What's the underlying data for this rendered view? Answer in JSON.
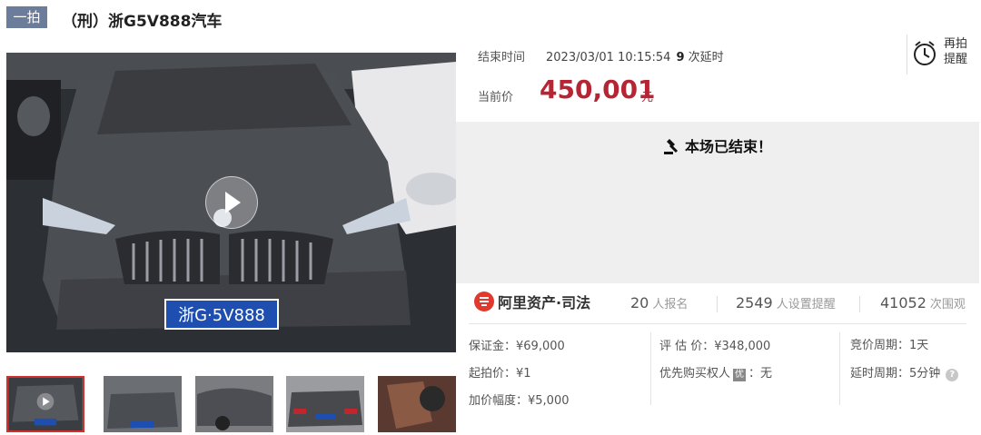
{
  "header": {
    "badge": "一拍",
    "title": "（刑）浙G5V888汽车"
  },
  "gallery": {
    "plate_text": "浙G·5V888",
    "thumbnails": [
      {
        "name": "thumb-1",
        "active": true,
        "has_play": true
      },
      {
        "name": "thumb-2",
        "active": false
      },
      {
        "name": "thumb-3",
        "active": false
      },
      {
        "name": "thumb-4",
        "active": false
      },
      {
        "name": "thumb-5",
        "active": false
      }
    ],
    "icons": {
      "play": "play-icon"
    }
  },
  "auction": {
    "end_time_label": "结束时间",
    "end_time_value": "2023/03/01 10:15:54",
    "extensions_count": "9",
    "extensions_label": "次延时",
    "current_price_label": "当前价",
    "current_price": "450,001",
    "price_unit": "元",
    "reminder_label_1": "再拍",
    "reminder_label_2": "提醒",
    "ended_text": "本场已结束！"
  },
  "platform": {
    "name": "阿里资产·司法",
    "signups_value": "20",
    "signups_label": "人报名",
    "reminders_value": "2549",
    "reminders_label": "人设置提醒",
    "views_value": "41052",
    "views_label": "次围观"
  },
  "details": {
    "deposit": "保证金：¥69,000",
    "start_price": "起拍价：¥1",
    "increment": "加价幅度：¥5,000",
    "appraisal": "评 估 价：¥348,000",
    "priority_label": "优先购买权人",
    "priority_icon": "优",
    "priority_value": "：无",
    "bid_period": "竞价周期：1天",
    "extend_period": "延时周期：5分钟",
    "help_icon": "?"
  },
  "colors": {
    "price": "#b52534",
    "badge": "#6c7d9c",
    "ended_bg": "#efefef",
    "active_thumb_border": "#d0312d",
    "brand": "#e03a2f"
  }
}
